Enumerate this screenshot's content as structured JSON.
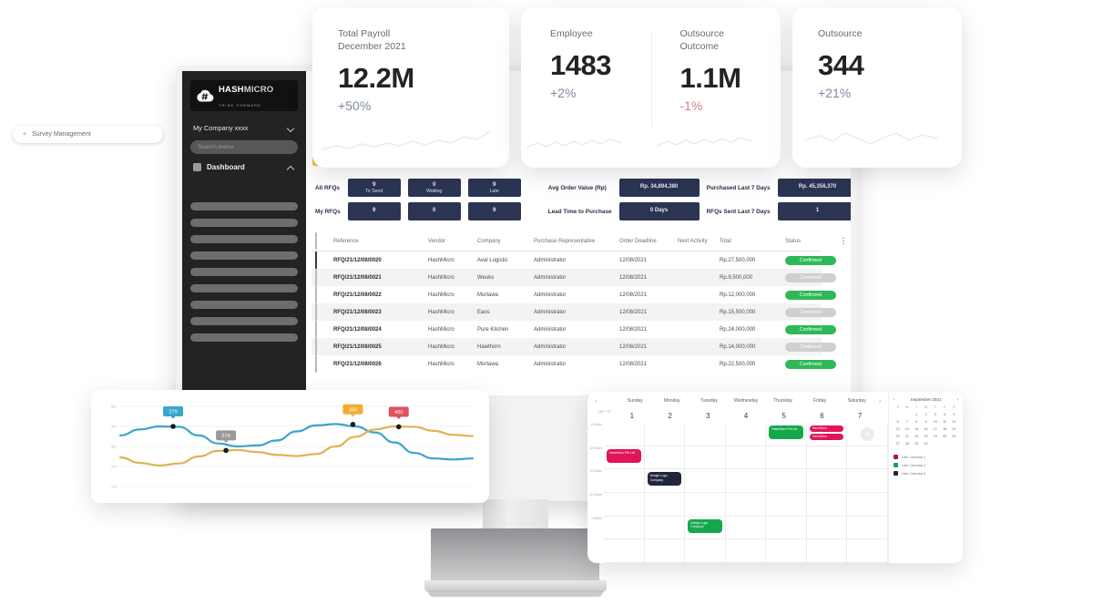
{
  "kpi_cards": [
    {
      "title": "Total Payroll\nDecember 2021",
      "title_line1": "Total Payroll",
      "title_line2": "December 2021",
      "value": "12.2M",
      "delta": "+50%",
      "delta_dir": "up"
    },
    {
      "title_line1": "Employee",
      "title_line2": "",
      "value": "1483",
      "delta": "+2%",
      "delta_dir": "up"
    },
    {
      "title_line1": "Outsource",
      "title_line2": "Outcome",
      "value": "1.1M",
      "delta": "-1%",
      "delta_dir": "down"
    },
    {
      "title_line1": "Outsource",
      "title_line2": "",
      "value": "344",
      "delta": "+21%",
      "delta_dir": "up"
    }
  ],
  "sidebar": {
    "logo": {
      "name_part1": "HASH",
      "name_part2": "MICRO",
      "tagline": "THINK FORWARD",
      "icon": "hashmicro-cloud-icon"
    },
    "company_selector": "My Company xxxx",
    "search_placeholder": "Search menu",
    "nav_items": [
      {
        "label": "Dashboard",
        "icon": "dashboard-square-icon",
        "expanded": true
      }
    ],
    "submenu_item": {
      "label": "Survey Management",
      "prefix": "+"
    },
    "skeleton_items": 9
  },
  "stats": {
    "left": {
      "rows": [
        {
          "label": "All RFQs",
          "cells": [
            {
              "num": "9",
              "cap": "To Send"
            },
            {
              "num": "0",
              "cap": "Waiting"
            },
            {
              "num": "9",
              "cap": "Late"
            }
          ]
        },
        {
          "label": "My RFQs",
          "cells": [
            {
              "num": "9",
              "cap": ""
            },
            {
              "num": "0",
              "cap": ""
            },
            {
              "num": "9",
              "cap": ""
            }
          ]
        }
      ]
    },
    "right": {
      "rows": [
        {
          "label": "Avg Order Value (Rp)",
          "value": "Rp. 34,894,380",
          "label2": "Purchased Last 7 Days",
          "value2": "Rp. 45,356,370"
        },
        {
          "label": "Lead Time to Purchase",
          "value": "0 Days",
          "label2": "RFQs Sent Last 7 Days",
          "value2": "1"
        }
      ]
    }
  },
  "table": {
    "columns": [
      "Reference",
      "Vendor",
      "Company",
      "Purchase Representative",
      "Order Deadline",
      "Next Activity",
      "Total",
      "Status"
    ],
    "rows": [
      {
        "checked": true,
        "reference": "RFQ/21/12/08/0020",
        "vendor": "HashMicro",
        "company": "Aval Logistic",
        "rep": "Administrator",
        "deadline": "12/08/2021",
        "activity": "green",
        "total": "Rp.27,500,000",
        "status": "Confirmed",
        "status_type": "ok"
      },
      {
        "checked": false,
        "reference": "RFQ/21/12/08/0021",
        "vendor": "HashMicro",
        "company": "Weuks",
        "rep": "Administrator",
        "deadline": "12/08/2021",
        "activity": "grey",
        "total": "Rp.9,500,000",
        "status": "Confirmed",
        "status_type": "muted"
      },
      {
        "checked": false,
        "reference": "RFQ/21/12/08/0022",
        "vendor": "HashMicro",
        "company": "Mortawa",
        "rep": "Administrator",
        "deadline": "12/08/2021",
        "activity": "green",
        "total": "Rp.12,000,000",
        "status": "Confirmed",
        "status_type": "ok"
      },
      {
        "checked": false,
        "reference": "RFQ/21/12/08/0023",
        "vendor": "HashMicro",
        "company": "Eaos",
        "rep": "Administrator",
        "deadline": "12/08/2021",
        "activity": "grey",
        "total": "Rp.15,500,000",
        "status": "Confirmed",
        "status_type": "muted"
      },
      {
        "checked": false,
        "reference": "RFQ/21/12/08/0024",
        "vendor": "HashMicro",
        "company": "Pure Kitchen",
        "rep": "Administrator",
        "deadline": "12/08/2021",
        "activity": "green",
        "total": "Rp.24,000,000",
        "status": "Confirmed",
        "status_type": "ok"
      },
      {
        "checked": false,
        "reference": "RFQ/21/12/08/0025",
        "vendor": "HashMicro",
        "company": "Hawthorn",
        "rep": "Administrator",
        "deadline": "12/08/2021",
        "activity": "grey",
        "total": "Rp.14,000,000",
        "status": "Confirmed",
        "status_type": "muted"
      },
      {
        "checked": false,
        "reference": "RFQ/21/12/08/0026",
        "vendor": "HashMicro",
        "company": "Mortawa",
        "rep": "Administrator",
        "deadline": "12/08/2021",
        "activity": "green",
        "total": "Rp.22,500,000",
        "status": "Confirmed",
        "status_type": "ok"
      }
    ]
  },
  "chart_data": {
    "type": "line",
    "title": "",
    "xlabel": "",
    "ylabel": "",
    "ylim": [
      100,
      500
    ],
    "ytick_labels": [
      "500",
      "400",
      "300",
      "200",
      "100"
    ],
    "grid": true,
    "legend": "none",
    "annotations": [
      {
        "label": "279",
        "color": "#3aa5cd",
        "series": "blue",
        "x_frac": 0.15,
        "value": 400
      },
      {
        "label": "279",
        "color": "#9a9a9a",
        "series": "yellow",
        "x_frac": 0.3,
        "value": 280
      },
      {
        "label": "360",
        "color": "#f0ad33",
        "series": "blue",
        "x_frac": 0.66,
        "value": 410
      },
      {
        "label": "400",
        "color": "#e0535e",
        "series": "yellow",
        "x_frac": 0.79,
        "value": 398
      }
    ],
    "series": [
      {
        "name": "blue",
        "color": "#3aa5cd",
        "values": [
          355,
          385,
          400,
          398,
          355,
          315,
          300,
          305,
          330,
          375,
          405,
          412,
          400,
          370,
          320,
          268,
          240,
          235,
          240
        ]
      },
      {
        "name": "yellow",
        "color": "#ddb451",
        "values": [
          245,
          218,
          205,
          215,
          250,
          278,
          282,
          272,
          258,
          252,
          262,
          300,
          348,
          385,
          400,
          398,
          378,
          358,
          352
        ]
      }
    ]
  },
  "calendar": {
    "prev_label": "‹",
    "next_label": "›",
    "day_names": [
      "Sunday",
      "Monday",
      "Tuesday",
      "Wednesday",
      "Thursday",
      "Friday",
      "Saturday"
    ],
    "dates": [
      "1",
      "2",
      "3",
      "4",
      "5",
      "6",
      "7"
    ],
    "time_labels": [
      "GMT +07",
      "8:00am",
      "10:00am",
      "11:00am",
      "12:00pm",
      "1:00pm"
    ],
    "add_button": "+",
    "events": [
      {
        "title": "HashMicro Pte Ltd",
        "day": 4,
        "row": 0,
        "color": "#15a84b",
        "size": "lg"
      },
      {
        "title": "HashMicro",
        "day": 5,
        "row": 0,
        "color": "#e0145b",
        "size": "sm"
      },
      {
        "title": "HashMicro",
        "day": 5,
        "row": 0,
        "color": "#e0145b",
        "size": "sm2"
      },
      {
        "title": "HashMicro Pte Ltd",
        "day": 0,
        "row": 1,
        "color": "#e0145b",
        "size": "lg"
      },
      {
        "title": "Design Logo Company",
        "day": 1,
        "row": 2,
        "color": "#22263a",
        "size": "lg"
      },
      {
        "title": "Design Logo Company",
        "day": 2,
        "row": 4,
        "color": "#15a84b",
        "size": "lg"
      }
    ],
    "mini": {
      "month": "September 2021",
      "dow": [
        "S",
        "M",
        "T",
        "W",
        "T",
        "F",
        "S"
      ],
      "weeks": [
        [
          "",
          "",
          "1",
          "2",
          "3",
          "4",
          "5"
        ],
        [
          "6",
          "7",
          "8",
          "9",
          "10",
          "11",
          "12"
        ],
        [
          "13",
          "14",
          "15",
          "16",
          "17",
          "18",
          "19"
        ],
        [
          "20",
          "21",
          "22",
          "23",
          "24",
          "25",
          "26"
        ],
        [
          "27",
          "28",
          "29",
          "30",
          "",
          "",
          ""
        ]
      ]
    },
    "legend": [
      {
        "label": "User Calendar 1",
        "color": "#b3174a"
      },
      {
        "label": "User Calendar 2",
        "color": "#15a84b"
      },
      {
        "label": "User Calendar 3",
        "color": "#22263a"
      }
    ]
  }
}
